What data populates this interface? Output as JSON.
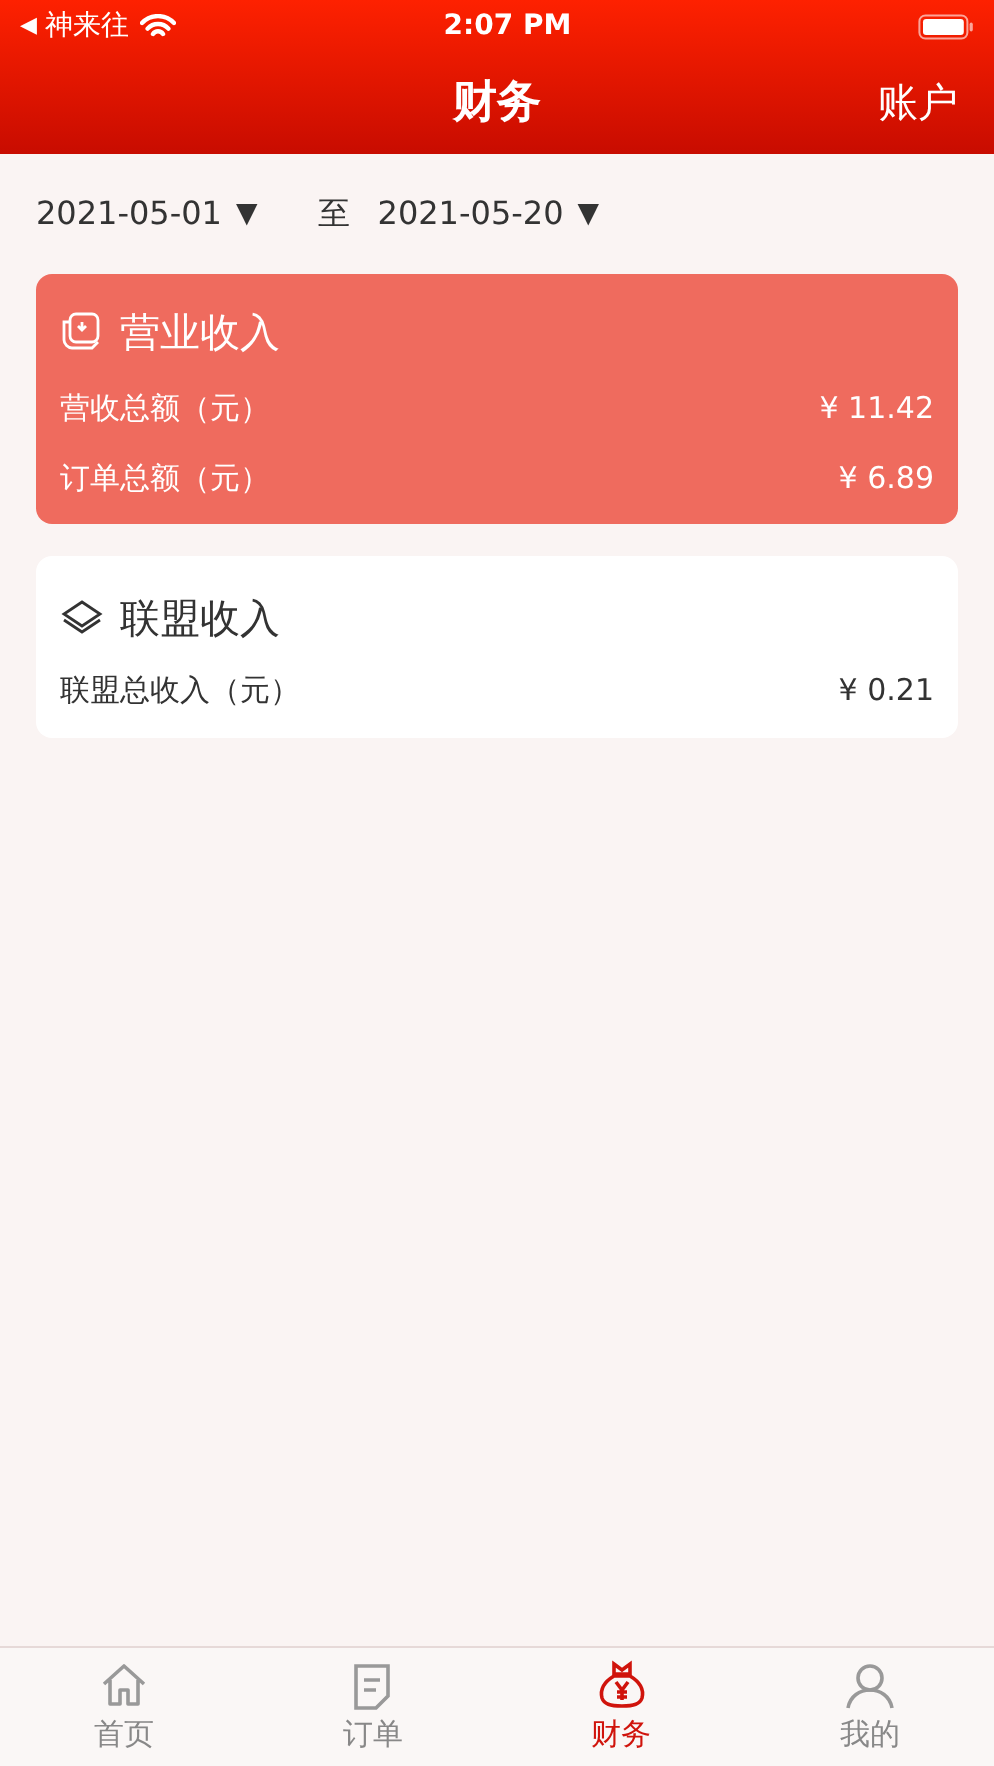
{
  "status_bar": {
    "back": "◀",
    "carrier": "神来往",
    "time": "2:07 PM"
  },
  "header": {
    "title": "财务",
    "action": "账户"
  },
  "date_range": {
    "start": "2021-05-01",
    "start_caret": "▼",
    "separator": "至",
    "end": "2021-05-20",
    "end_caret": "▼"
  },
  "cards": [
    {
      "kind": "highlight",
      "title": "营业收入",
      "rows": [
        {
          "label": "营收总额（元）",
          "value": "¥ 11.42"
        },
        {
          "label": "订单总额（元）",
          "value": "¥ 6.89"
        }
      ]
    },
    {
      "kind": "plain",
      "title": "联盟收入",
      "rows": [
        {
          "label": "联盟总收入（元）",
          "value": "¥ 0.21"
        }
      ]
    }
  ],
  "tabs": [
    {
      "label": "首页",
      "selected": false
    },
    {
      "label": "订单",
      "selected": false
    },
    {
      "label": "财务",
      "selected": true
    },
    {
      "label": "我的",
      "selected": false
    }
  ]
}
